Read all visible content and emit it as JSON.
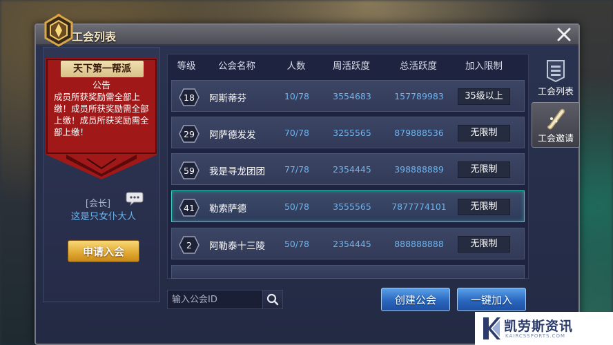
{
  "window": {
    "title": "工会列表"
  },
  "guild_banner": {
    "title": "天下第一帮派",
    "subtitle": "公告",
    "notice": "成员所获奖励需全部上缴！成员所获奖励需全部上缴！成员所获奖励需全部上缴！"
  },
  "leader": {
    "label": "[会长]",
    "name": "这是只女仆大人"
  },
  "apply_button": "申请入会",
  "table": {
    "headers": [
      "等级",
      "公会名称",
      "人数",
      "周活跃度",
      "总活跃度",
      "加入限制"
    ],
    "rows": [
      {
        "level": "18",
        "name": "阿斯蒂芬",
        "members": "10/78",
        "weekly": "3554683",
        "total": "157789983",
        "limit": "35级以上"
      },
      {
        "level": "29",
        "name": "阿萨德发发",
        "members": "70/78",
        "weekly": "3255565",
        "total": "879888536",
        "limit": "无限制"
      },
      {
        "level": "59",
        "name": "我是寻龙团团",
        "members": "77/78",
        "weekly": "2354445",
        "total": "398888889",
        "limit": "无限制"
      },
      {
        "level": "41",
        "name": "勒索萨德",
        "members": "50/78",
        "weekly": "3555565",
        "total": "7877774101",
        "limit": "无限制"
      },
      {
        "level": "2",
        "name": "阿勒泰十三陵",
        "members": "50/78",
        "weekly": "2354445",
        "total": "888888888",
        "limit": "无限制"
      }
    ]
  },
  "search": {
    "placeholder": "输入公会ID"
  },
  "buttons": {
    "create": "创建公会",
    "quick_join": "一键加入"
  },
  "side_tabs": {
    "guild_list": "工会列表",
    "guild_invite": "工会邀请"
  },
  "watermark": {
    "text": "凯劳斯资讯",
    "sub": "KAIRCSSPORTS.COM"
  },
  "colors": {
    "accent_blue": "#6ab4f0",
    "gold": "#e0a830",
    "selected_border": "#3ad0c0"
  }
}
